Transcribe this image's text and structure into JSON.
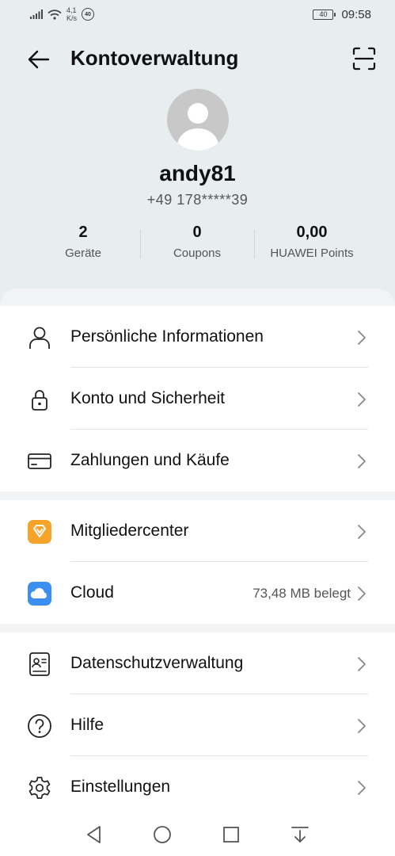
{
  "status_bar": {
    "net_speed_value": "4,1",
    "net_speed_unit": "K/s",
    "badge": "40",
    "battery": "40",
    "time": "09:58"
  },
  "header": {
    "title": "Kontoverwaltung"
  },
  "profile": {
    "username": "andy81",
    "phone": "+49  178*****39"
  },
  "stats": [
    {
      "value": "2",
      "label": "Geräte"
    },
    {
      "value": "0",
      "label": "Coupons"
    },
    {
      "value": "0,00",
      "label": "HUAWEI Points"
    }
  ],
  "menu": {
    "group1": [
      {
        "label": "Persönliche Informationen",
        "icon": "person-icon"
      },
      {
        "label": "Konto und Sicherheit",
        "icon": "lock-icon"
      },
      {
        "label": "Zahlungen und Käufe",
        "icon": "credit-card-icon"
      }
    ],
    "group2": [
      {
        "label": "Mitgliedercenter",
        "icon": "diamond-icon",
        "icon_color": "#f6a32a"
      },
      {
        "label": "Cloud",
        "icon": "cloud-icon",
        "icon_color": "#3b8ff0",
        "value": "73,48 MB belegt"
      }
    ],
    "group3": [
      {
        "label": "Datenschutzverwaltung",
        "icon": "privacy-icon"
      },
      {
        "label": "Hilfe",
        "icon": "help-icon"
      },
      {
        "label": "Einstellungen",
        "icon": "settings-icon"
      }
    ]
  },
  "colors": {
    "header_bg": "#e8edf0",
    "card_bg": "#ffffff",
    "accent_orange": "#f6a32a",
    "accent_blue": "#3b8ff0"
  }
}
